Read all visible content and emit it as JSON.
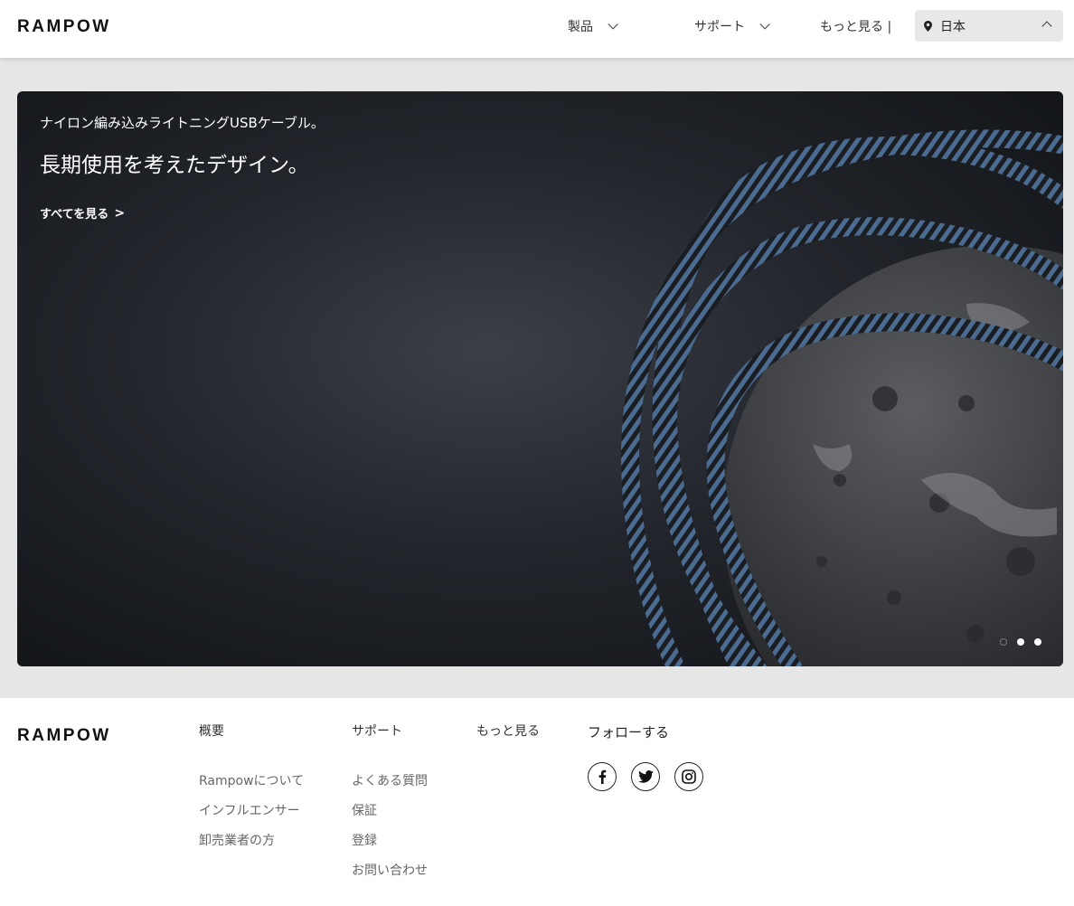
{
  "header": {
    "logo": "RAMPOW",
    "nav": {
      "products": "製品",
      "support": "サポート",
      "more": "もっと見る |"
    },
    "region": "日本"
  },
  "hero": {
    "subtitle": "ナイロン編み込みライトニングUSBケーブル。",
    "title": "長期使用を考えたデザイン。",
    "link": "すべてを見る",
    "link_arrow": ">",
    "slide_count": 3,
    "active_slide": 1
  },
  "footer": {
    "logo": "RAMPOW",
    "about": {
      "heading": "概要",
      "items": [
        "Rampowについて",
        "インフルエンサー",
        "卸売業者の方"
      ]
    },
    "support": {
      "heading": "サポート",
      "items": [
        "よくある質問",
        "保証",
        "登録",
        "お問い合わせ"
      ]
    },
    "more": {
      "heading": "もっと見る"
    },
    "follow": {
      "heading": "フォローする",
      "icons": [
        "facebook-icon",
        "twitter-icon",
        "instagram-icon"
      ]
    }
  },
  "colors": {
    "page_bg": "#e6e6e6",
    "header_bg": "#ffffff",
    "region_bg": "#e8e8e8",
    "hero_bg": "#1c1f24",
    "cable_blue": "#4a6a8f"
  }
}
